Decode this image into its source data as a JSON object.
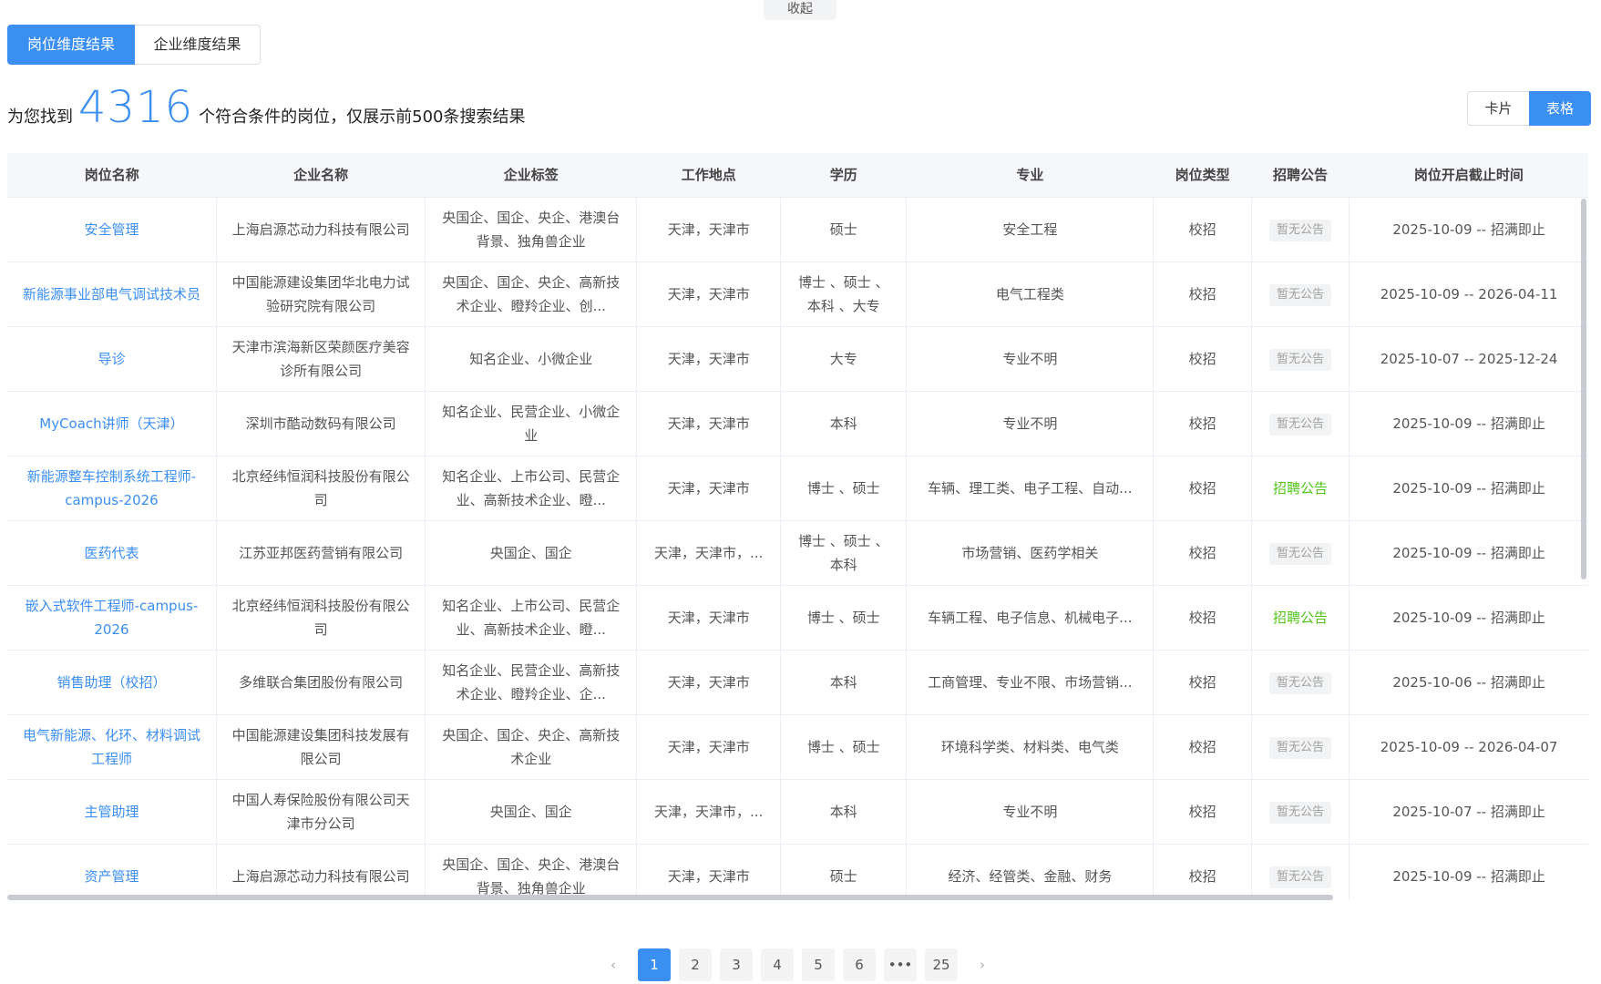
{
  "collapse_label": "收起",
  "tabs": [
    {
      "label": "岗位维度结果"
    },
    {
      "label": "企业维度结果"
    }
  ],
  "summary": {
    "prefix": "为您找到",
    "count": "4316",
    "suffix": "个符合条件的岗位，仅展示前500条搜索结果"
  },
  "view_toggle": {
    "card": "卡片",
    "table": "表格"
  },
  "columns": [
    "岗位名称",
    "企业名称",
    "企业标签",
    "工作地点",
    "学历",
    "专业",
    "岗位类型",
    "招聘公告",
    "岗位开启截止时间"
  ],
  "rows": [
    {
      "job": "安全管理",
      "company": "上海启源芯动力科技有限公司",
      "tags": "央国企、国企、央企、港澳台背景、独角兽企业",
      "location": "天津，天津市",
      "edu": "硕士",
      "major": "安全工程",
      "type": "校招",
      "notice": "暂无公告",
      "time": "2025-10-09 -- 招满即止"
    },
    {
      "job": "新能源事业部电气调试技术员",
      "company": "中国能源建设集团华北电力试验研究院有限公司",
      "tags": "央国企、国企、央企、高新技术企业、瞪羚企业、创...",
      "location": "天津，天津市",
      "edu": "博士 、硕士 、本科 、大专",
      "major": "电气工程类",
      "type": "校招",
      "notice": "暂无公告",
      "time": "2025-10-09 -- 2026-04-11"
    },
    {
      "job": "导诊",
      "company": "天津市滨海新区荣颜医疗美容诊所有限公司",
      "tags": "知名企业、小微企业",
      "location": "天津，天津市",
      "edu": "大专",
      "major": "专业不明",
      "type": "校招",
      "notice": "暂无公告",
      "time": "2025-10-07 -- 2025-12-24"
    },
    {
      "job": "MyCoach讲师（天津）",
      "company": "深圳市酷动数码有限公司",
      "tags": "知名企业、民营企业、小微企业",
      "location": "天津，天津市",
      "edu": "本科",
      "major": "专业不明",
      "type": "校招",
      "notice": "暂无公告",
      "time": "2025-10-09 -- 招满即止"
    },
    {
      "job": "新能源整车控制系统工程师-campus-2026",
      "company": "北京经纬恒润科技股份有限公司",
      "tags": "知名企业、上市公司、民营企业、高新技术企业、瞪...",
      "location": "天津，天津市",
      "edu": "博士 、硕士",
      "major": "车辆、理工类、电子工程、自动...",
      "type": "校招",
      "notice": "招聘公告",
      "time": "2025-10-09 -- 招满即止"
    },
    {
      "job": "医药代表",
      "company": "江苏亚邦医药营销有限公司",
      "tags": "央国企、国企",
      "location": "天津，天津市，...",
      "edu": "博士 、硕士 、本科",
      "major": "市场营销、医药学相关",
      "type": "校招",
      "notice": "暂无公告",
      "time": "2025-10-09 -- 招满即止"
    },
    {
      "job": "嵌入式软件工程师-campus-2026",
      "company": "北京经纬恒润科技股份有限公司",
      "tags": "知名企业、上市公司、民营企业、高新技术企业、瞪...",
      "location": "天津，天津市",
      "edu": "博士 、硕士",
      "major": "车辆工程、电子信息、机械电子...",
      "type": "校招",
      "notice": "招聘公告",
      "time": "2025-10-09 -- 招满即止"
    },
    {
      "job": "销售助理（校招）",
      "company": "多维联合集团股份有限公司",
      "tags": "知名企业、民营企业、高新技术企业、瞪羚企业、企...",
      "location": "天津，天津市",
      "edu": "本科",
      "major": "工商管理、专业不限、市场营销...",
      "type": "校招",
      "notice": "暂无公告",
      "time": "2025-10-06 -- 招满即止"
    },
    {
      "job": "电气新能源、化环、材料调试工程师",
      "company": "中国能源建设集团科技发展有限公司",
      "tags": "央国企、国企、央企、高新技术企业",
      "location": "天津，天津市",
      "edu": "博士 、硕士",
      "major": "环境科学类、材料类、电气类",
      "type": "校招",
      "notice": "暂无公告",
      "time": "2025-10-09 -- 2026-04-07"
    },
    {
      "job": "主管助理",
      "company": "中国人寿保险股份有限公司天津市分公司",
      "tags": "央国企、国企",
      "location": "天津，天津市，...",
      "edu": "本科",
      "major": "专业不明",
      "type": "校招",
      "notice": "暂无公告",
      "time": "2025-10-07 -- 招满即止"
    },
    {
      "job": "资产管理",
      "company": "上海启源芯动力科技有限公司",
      "tags": "央国企、国企、央企、港澳台背景、独角兽企业",
      "location": "天津，天津市",
      "edu": "硕士",
      "major": "经济、经管类、金融、财务",
      "type": "校招",
      "notice": "暂无公告",
      "time": "2025-10-09 -- 招满即止"
    }
  ],
  "pagination": {
    "pages": [
      "1",
      "2",
      "3",
      "4",
      "5",
      "6",
      "•••",
      "25"
    ],
    "current": "1",
    "prev_icon": "‹",
    "next_icon": "›"
  },
  "icons": {
    "prev": "chevron-left-icon",
    "next": "chevron-right-icon"
  },
  "colors": {
    "accent": "#3b8ff0",
    "notice_available": "#52c41a",
    "notice_empty": "#a0a0a0"
  }
}
